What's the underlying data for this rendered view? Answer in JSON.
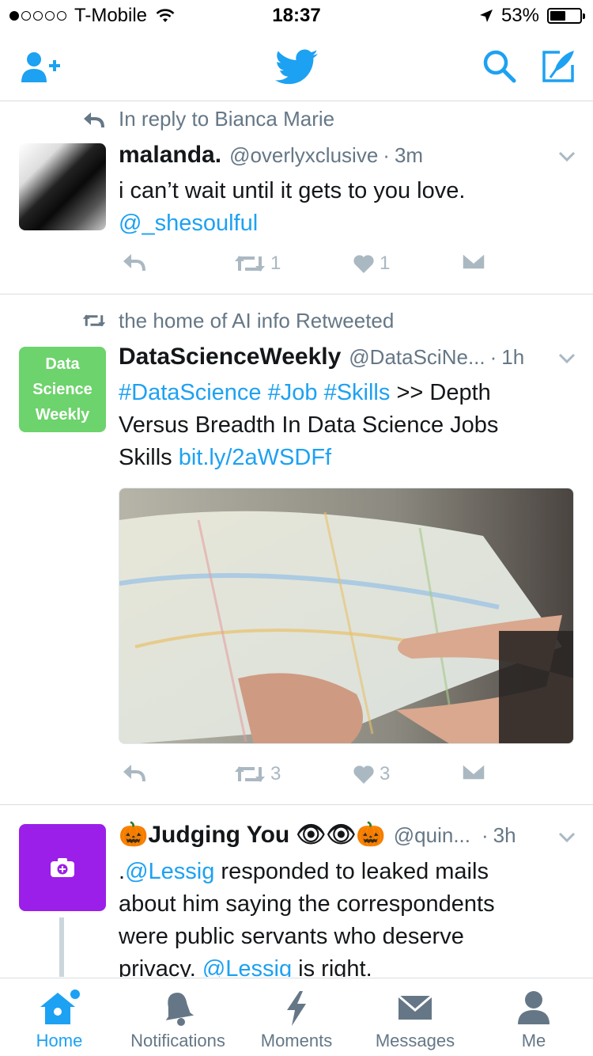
{
  "status_bar": {
    "carrier": "T-Mobile",
    "time": "18:37",
    "battery": "53%",
    "signal_bars_filled": 1,
    "signal_bars_total": 5
  },
  "nav": {
    "left_icon": "add-user-icon",
    "center_icon": "twitter-bird-icon",
    "right_icons": [
      "search-icon",
      "compose-icon"
    ],
    "accent": "#1DA1F2"
  },
  "tweets": [
    {
      "context": "In reply to Bianca Marie",
      "name": "malanda.",
      "handle": "@overlyxclusive",
      "sep": "·",
      "time": "3m",
      "text": "i can’t wait until it gets to you love.",
      "mention": "@_shesoulful",
      "retweets": "1",
      "likes": "1"
    },
    {
      "context": "the home of AI info Retweeted",
      "name": "DataScienceWeekly",
      "handle": "@DataSciNe...",
      "sep": "·",
      "time": "1h",
      "avatar_text": [
        "Data",
        "Science",
        "Weekly"
      ],
      "hashtags": [
        "#DataScience",
        "#Job",
        "#Skills"
      ],
      "text_after_tags": ">> Depth",
      "text_line2": "Versus Breadth In Data Science Jobs",
      "text_line3_prefix": "Skills",
      "url": "bit.ly/2aWSDFf",
      "retweets": "3",
      "likes": "3"
    },
    {
      "name_prefix_emoji": "🎃",
      "name": "Judging You",
      "name_suffix_emoji": "👁👁🎃",
      "handle": "@quin...",
      "sep": "·",
      "time": "3h",
      "line1_prefix": ".",
      "mention": "@Lessig",
      "line1_rest": "responded to leaked mails",
      "line2": "about him saying the correspondents",
      "line3": "were public servants who deserve",
      "line4_prefix": "privacy.",
      "line4_mention": "@Lessig",
      "line4_rest": "is right."
    }
  ],
  "tabs": [
    {
      "label": "Home",
      "icon": "home-icon",
      "active": true
    },
    {
      "label": "Notifications",
      "icon": "bell-icon",
      "active": false
    },
    {
      "label": "Moments",
      "icon": "lightning-icon",
      "active": false
    },
    {
      "label": "Messages",
      "icon": "envelope-icon",
      "active": false
    },
    {
      "label": "Me",
      "icon": "person-icon",
      "active": false
    }
  ]
}
